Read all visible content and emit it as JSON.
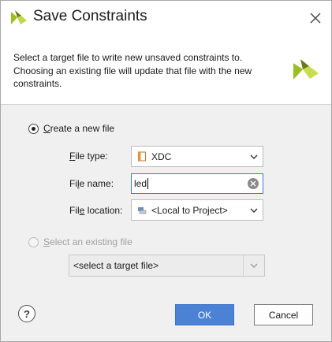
{
  "dialog": {
    "title": "Save Constraints",
    "description": "Select a target file to write new unsaved constraints to. Choosing an existing file will update that file with the new constraints."
  },
  "options": {
    "create_new": {
      "prefix": "",
      "underline": "C",
      "rest": "reate a new file",
      "checked": true
    },
    "file_type": {
      "label_u": "F",
      "label_rest": "ile type:",
      "value": "XDC",
      "icon": "xdc-file-icon"
    },
    "file_name": {
      "label_pre": "Fi",
      "label_u": "l",
      "label_rest": "e name:",
      "value": "led"
    },
    "file_location": {
      "label_pre": "Fil",
      "label_u": "e",
      "label_rest": " location:",
      "value": "<Local to Project>",
      "icon": "local-project-icon"
    },
    "select_existing": {
      "underline": "S",
      "rest": "elect an existing file",
      "checked": false,
      "enabled": false
    },
    "target_file": {
      "value": "<select a target file>"
    }
  },
  "buttons": {
    "help": "?",
    "ok": "OK",
    "cancel": "Cancel"
  },
  "colors": {
    "accent": "#4c82d6",
    "logo_green": "#9bbf1e",
    "logo_olive": "#6b7a12"
  }
}
